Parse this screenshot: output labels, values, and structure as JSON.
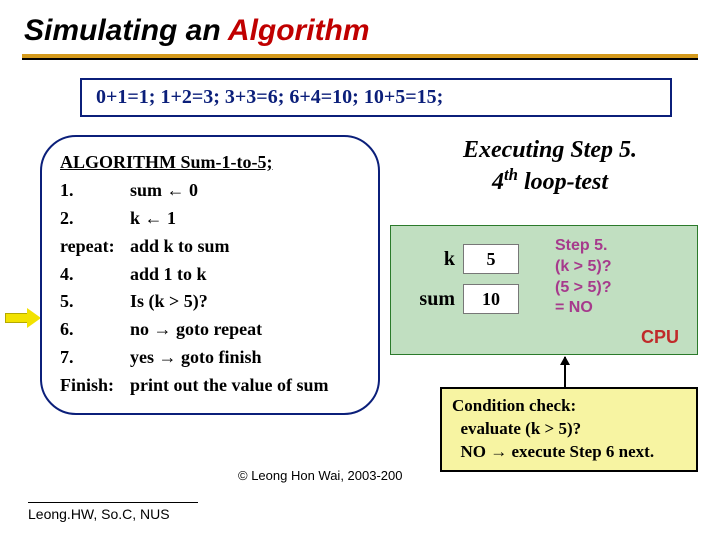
{
  "title_part1": "Simulating an ",
  "title_part2": "Algorithm",
  "formula": "0+1=1;  1+2=3;  3+3=6;  6+4=10;  10+5=15;",
  "algo": {
    "header": "ALGORITHM Sum-1-to-5;",
    "rows": [
      {
        "num": "1.",
        "body": "sum ← 0"
      },
      {
        "num": "2.",
        "body": "k ← 1"
      },
      {
        "num": "repeat:",
        "body": "add k to sum"
      },
      {
        "num": "4.",
        "body": "add 1 to k"
      },
      {
        "num": "5.",
        "body": "Is (k > 5)?"
      },
      {
        "num": "6.",
        "body": " no → goto repeat"
      },
      {
        "num": "7.",
        "body": " yes → goto finish"
      },
      {
        "num": "Finish:",
        "body": "print out the value of sum"
      }
    ]
  },
  "exec": {
    "line1": "Executing Step 5.",
    "line2_prefix": "4",
    "line2_sup": "th",
    "line2_suffix": " loop-test"
  },
  "cpu": {
    "k_label": "k",
    "k_value": "5",
    "sum_label": "sum",
    "sum_value": "10",
    "step5_l1": "Step 5.",
    "step5_l2": "(k > 5)?",
    "step5_l3": "(5 > 5)?",
    "step5_l4": "= NO",
    "label": "CPU"
  },
  "cond": {
    "l1": "Condition check:",
    "l2": "  evaluate (k > 5)?",
    "l3": "  NO → execute Step 6 next."
  },
  "copyright": "© Leong Hon Wai, 2003-200",
  "footer": "Leong.HW, So.C, NUS"
}
